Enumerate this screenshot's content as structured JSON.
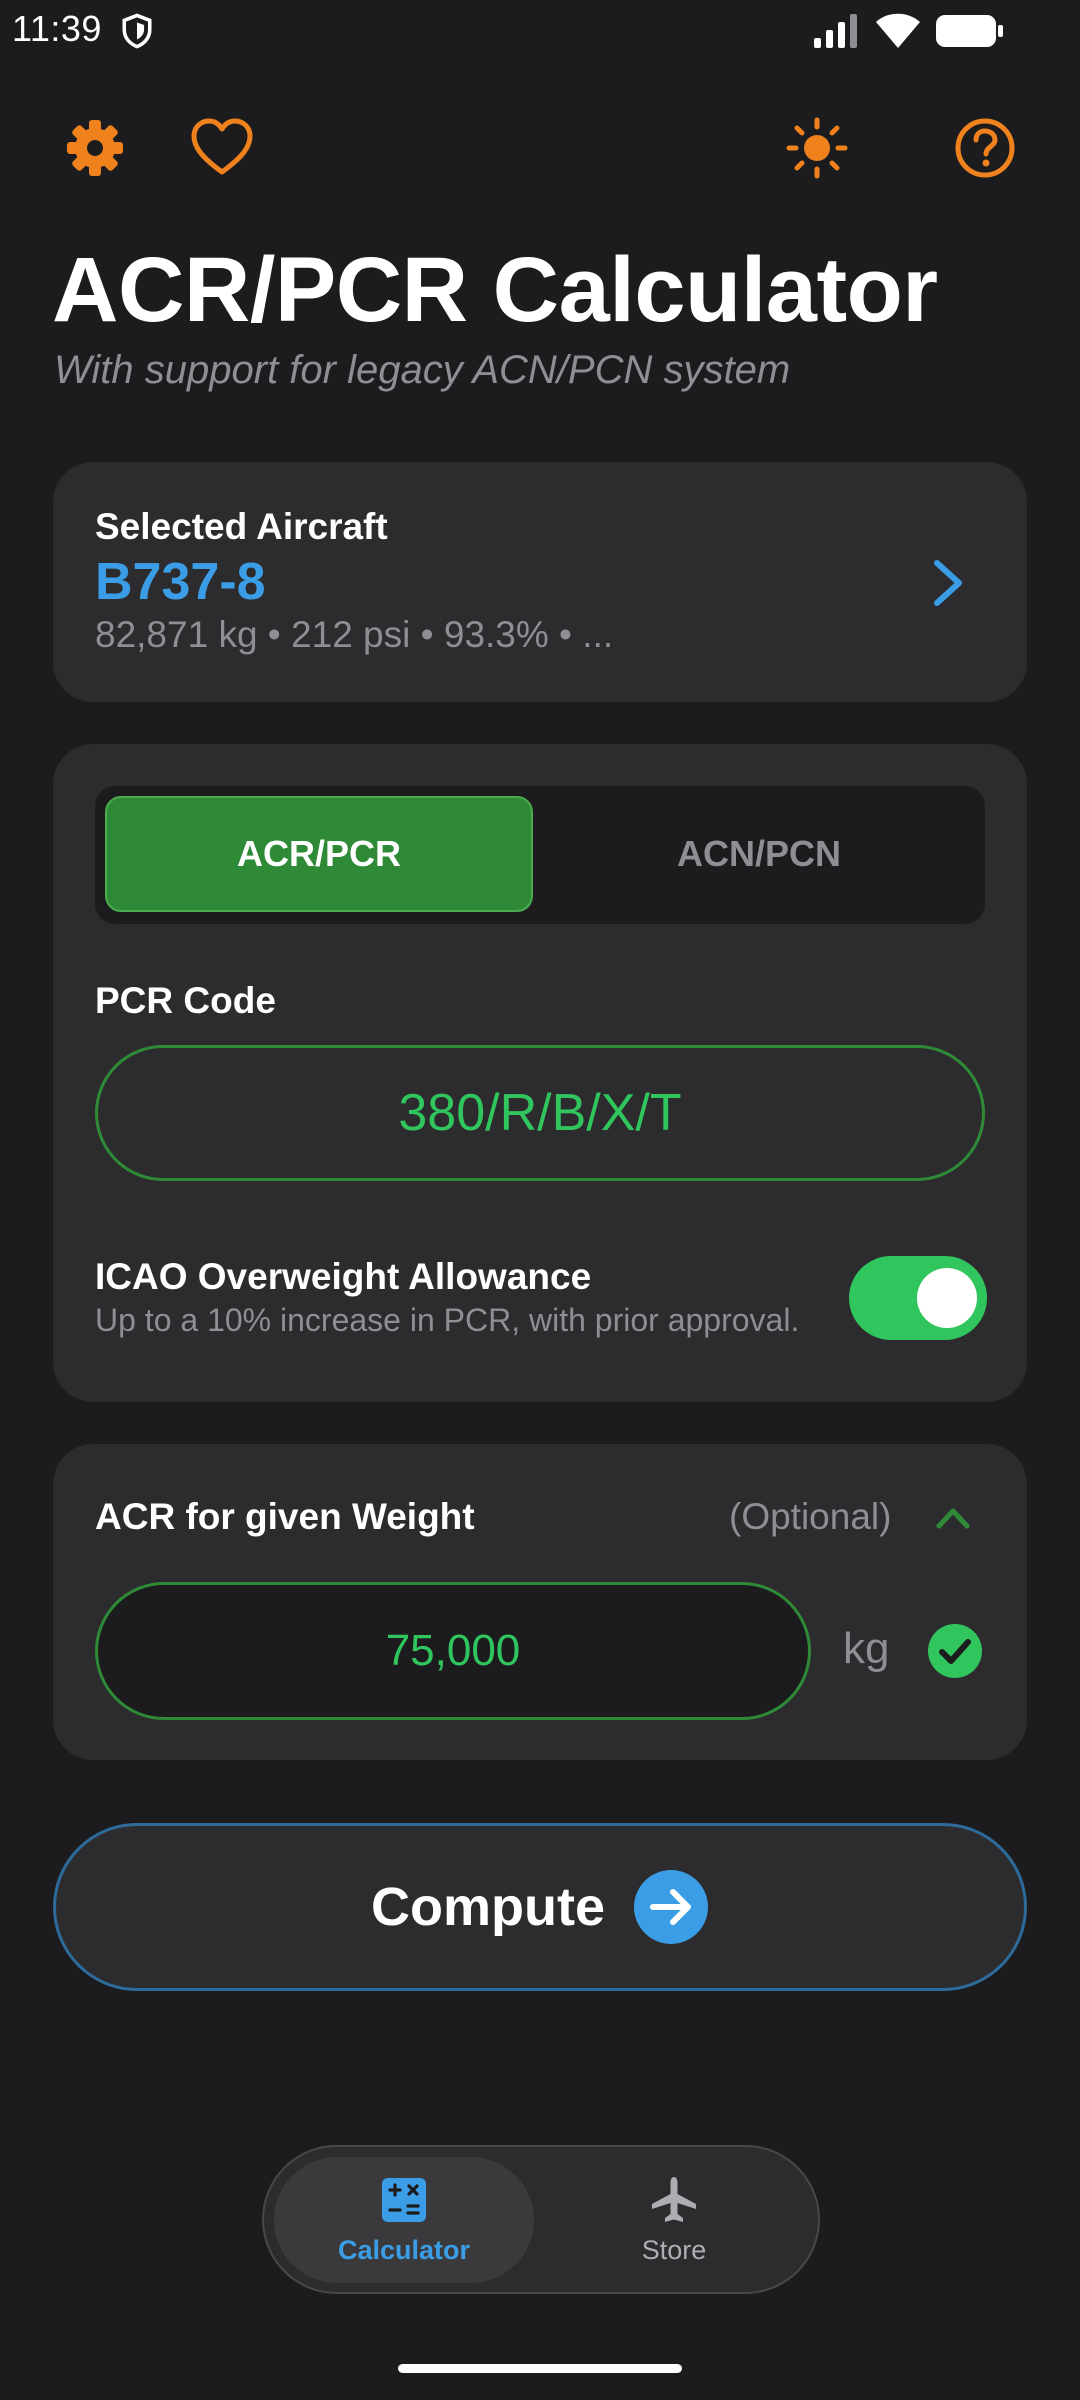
{
  "status_bar": {
    "time": "11:39",
    "icons": [
      "shield-icon",
      "signal-icon",
      "wifi-icon",
      "battery-icon"
    ]
  },
  "toolbar": {
    "icons": [
      "gear-icon",
      "heart-icon",
      "sun-icon",
      "help-icon"
    ]
  },
  "header": {
    "title": "ACR/PCR Calculator",
    "subtitle": "With support for legacy ACN/PCN system"
  },
  "aircraft": {
    "label": "Selected Aircraft",
    "name": "B737-8",
    "details": "82,871 kg • 212 psi • 93.3% • ..."
  },
  "mode": {
    "options": [
      "ACR/PCR",
      "ACN/PCN"
    ],
    "selected": "ACR/PCR"
  },
  "pcr": {
    "label": "PCR Code",
    "value": "380/R/B/X/T"
  },
  "icao": {
    "title": "ICAO Overweight Allowance",
    "description": "Up to a 10% increase in PCR, with prior approval.",
    "enabled": true
  },
  "weight": {
    "title": "ACR for given Weight",
    "optional_label": "(Optional)",
    "value": "75,000",
    "unit": "kg"
  },
  "compute": {
    "label": "Compute"
  },
  "bottom_nav": {
    "items": [
      {
        "label": "Calculator",
        "icon": "calculator-icon",
        "active": true
      },
      {
        "label": "Store",
        "icon": "airplane-icon",
        "active": false
      }
    ]
  },
  "colors": {
    "background": "#1c1c1e",
    "card": "#2c2c2e",
    "accent_orange": "#f0821e",
    "accent_blue": "#3b9de6",
    "accent_green": "#30c65d",
    "selected_green": "#2e8a36",
    "muted_text": "#8e8e93"
  }
}
